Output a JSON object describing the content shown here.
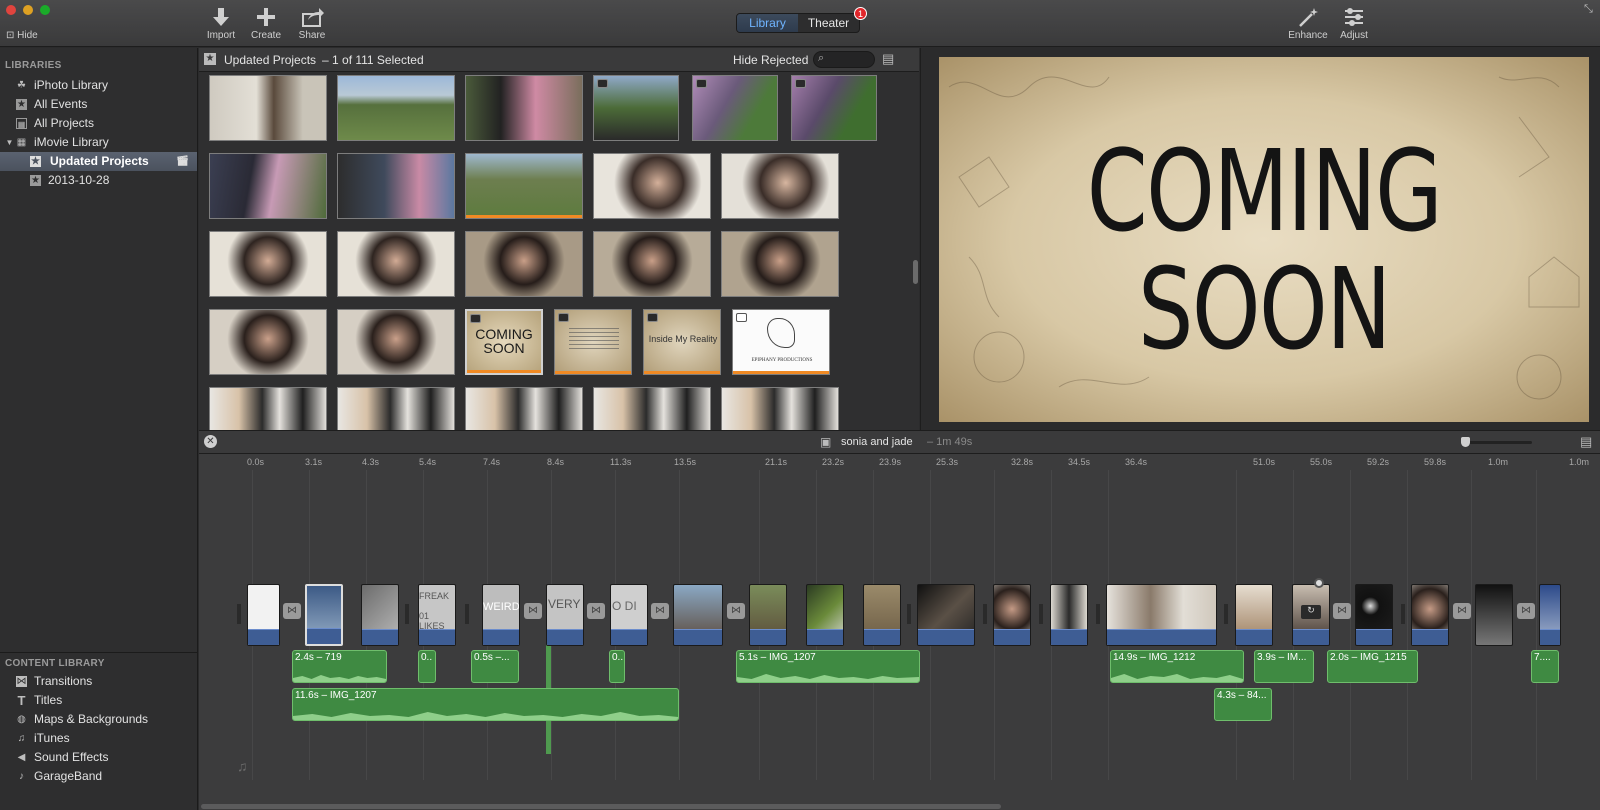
{
  "toolbar": {
    "hide_label": "Hide",
    "import_label": "Import",
    "create_label": "Create",
    "share_label": "Share",
    "library_tab": "Library",
    "theater_tab": "Theater",
    "theater_badge": "1",
    "enhance_label": "Enhance",
    "adjust_label": "Adjust",
    "colors": {
      "close": "#e0443e",
      "minimize": "#dea123",
      "zoom": "#1aab29"
    }
  },
  "sidebar": {
    "libraries_heading": "LIBRARIES",
    "items": [
      {
        "label": "iPhoto Library",
        "icon": "palm-tree-icon"
      },
      {
        "label": "All Events",
        "icon": "star-icon"
      },
      {
        "label": "All Projects",
        "icon": "film-grid-icon"
      },
      {
        "label": "iMovie Library",
        "icon": "grid-icon"
      },
      {
        "label": "Updated Projects",
        "icon": "star-icon",
        "selected": true
      },
      {
        "label": "2013-10-28",
        "icon": "star-icon"
      }
    ],
    "content_heading": "CONTENT LIBRARY",
    "content_items": [
      {
        "label": "Transitions",
        "icon": "transitions-icon"
      },
      {
        "label": "Titles",
        "icon": "titles-icon"
      },
      {
        "label": "Maps & Backgrounds",
        "icon": "globe-icon"
      },
      {
        "label": "iTunes",
        "icon": "music-note-icon"
      },
      {
        "label": "Sound Effects",
        "icon": "speaker-icon"
      },
      {
        "label": "GarageBand",
        "icon": "guitar-icon"
      }
    ]
  },
  "browser": {
    "title": "Updated Projects",
    "selection": "– 1 of 111 Selected",
    "filter": "Hide Rejected",
    "thumb_texts": {
      "coming_soon": "COMING SOON",
      "inside": "Inside My Reality",
      "epiphany": "EPIPHANY PRODUCTIONS"
    }
  },
  "viewer": {
    "line1": "COMING",
    "line2": "SOON"
  },
  "timeline": {
    "project_name": "sonia and jade",
    "duration": "– 1m 49s",
    "ticks": [
      "0.0s",
      "3.1s",
      "4.3s",
      "5.4s",
      "7.4s",
      "8.4s",
      "11.3s",
      "13.5s",
      "21.1s",
      "23.2s",
      "23.9s",
      "25.3s",
      "32.8s",
      "34.5s",
      "36.4s",
      "51.0s",
      "55.0s",
      "59.2s",
      "59.8s",
      "1.0m",
      "1.0m"
    ],
    "clip_texts": [
      "FREAK",
      "01 LIKES",
      "WEIRD",
      "VERY",
      "O DI"
    ],
    "audio_clips": [
      "2.4s – 719",
      "0..",
      "0.5s –...",
      "0..",
      "5.1s – IMG_1207",
      "14.9s – IMG_1212",
      "3.9s – IM...",
      "2.0s – IMG_1215",
      "7....",
      "11.6s – IMG_1207",
      "4.3s – 84..."
    ]
  }
}
